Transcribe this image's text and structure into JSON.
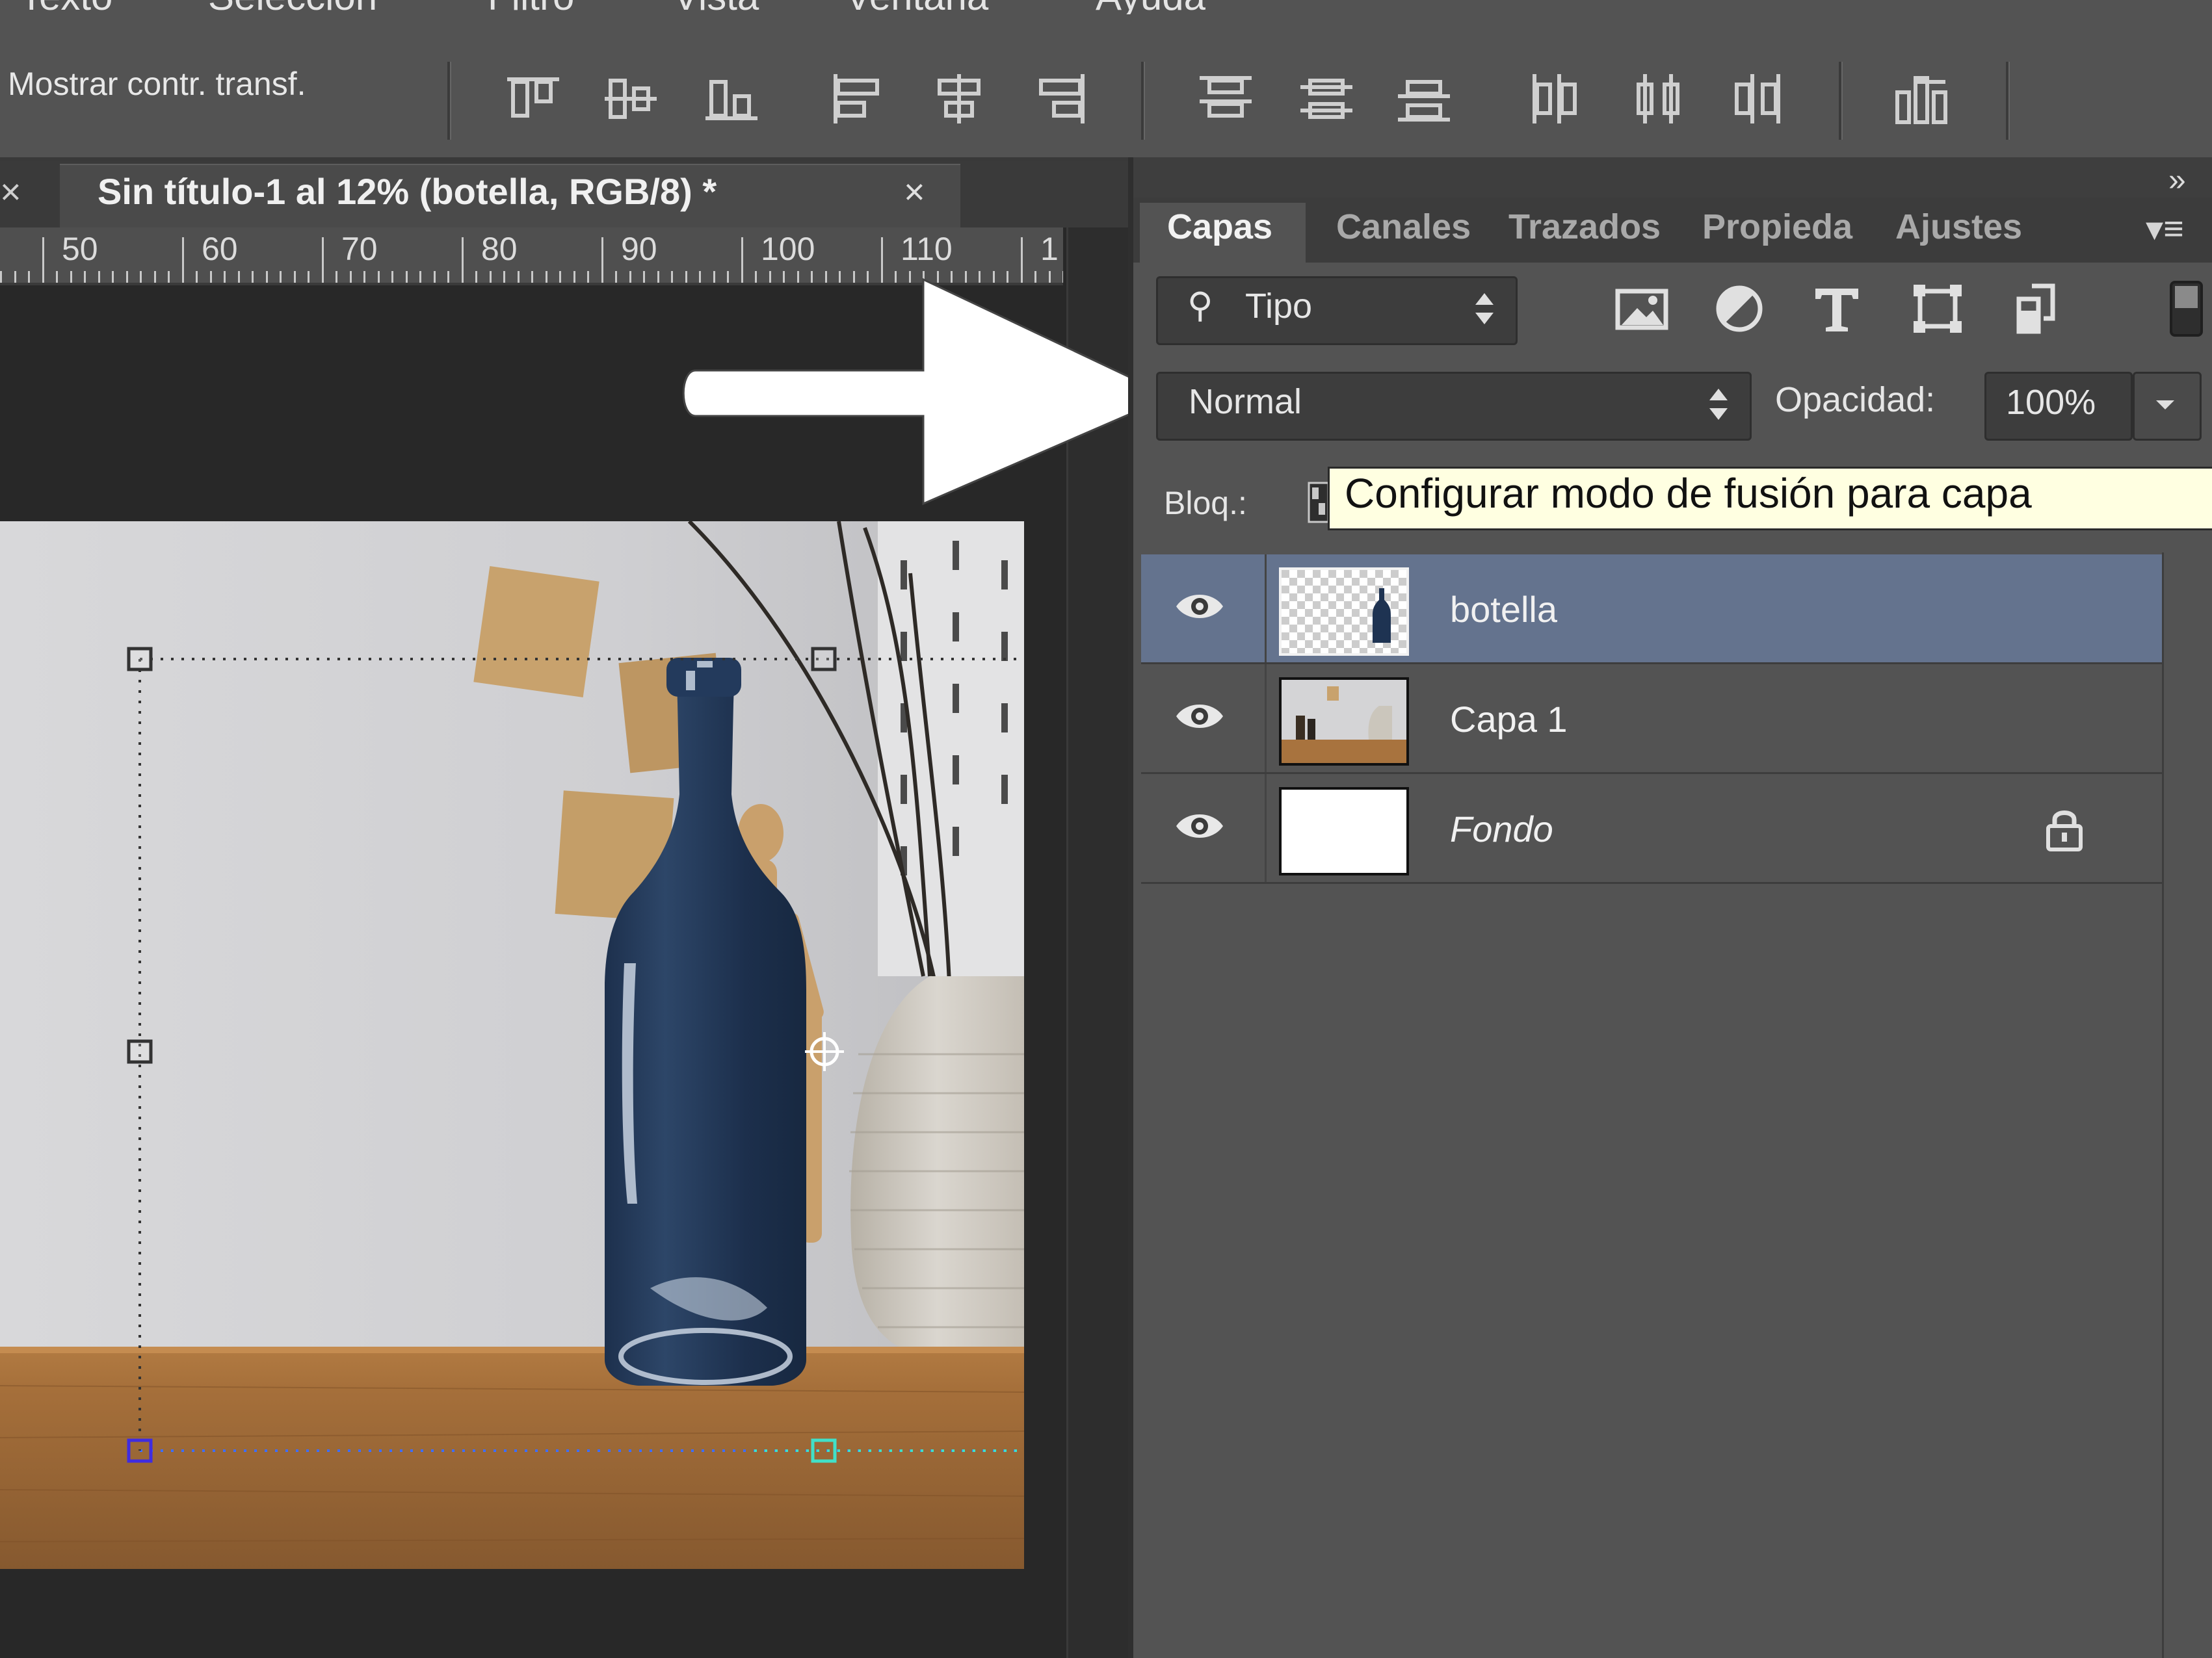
{
  "menu": {
    "items": [
      "Texto",
      "Selección",
      "Filtro",
      "Vista",
      "Ventana",
      "Ayuda"
    ]
  },
  "options_bar": {
    "show_transform_label": "Mostrar contr. transf.",
    "align_icons": [
      "align-top-edges-icon",
      "align-vertical-centers-icon",
      "align-bottom-edges-icon",
      "align-left-edges-icon",
      "align-horizontal-centers-icon",
      "align-right-edges-icon",
      "distribute-top-icon",
      "distribute-vertical-centers-icon",
      "distribute-bottom-icon",
      "distribute-left-icon",
      "distribute-horizontal-centers-icon",
      "distribute-right-icon",
      "auto-align-icon"
    ]
  },
  "document": {
    "prev_tab_close": "×",
    "tab_title": "Sin título-1 al 12% (botella, RGB/8) *",
    "tab_close": "×"
  },
  "ruler": {
    "labels": [
      "50",
      "60",
      "70",
      "80",
      "90",
      "100",
      "110",
      "1"
    ]
  },
  "panel": {
    "collapse_icon": "»",
    "tabs": [
      "Capas",
      "Canales",
      "Trazados",
      "Propieda",
      "Ajustes"
    ],
    "active_tab": "Capas",
    "menu_icon": "▾≡",
    "filter": {
      "label": "Tipo",
      "search_icon": "⚲"
    },
    "blend_mode": "Normal",
    "opacity_label": "Opacidad:",
    "opacity_value": "100%",
    "lock_label": "Bloq.:",
    "tooltip": "Configurar modo de fusión para capa",
    "layers": [
      {
        "name": "botella",
        "selected": true,
        "visible": true
      },
      {
        "name": "Capa 1",
        "selected": false,
        "visible": true
      },
      {
        "name": "Fondo",
        "selected": false,
        "visible": true,
        "locked": true,
        "italic": true
      }
    ]
  },
  "colors": {
    "ui_bg": "#535353",
    "dark_bg": "#282828",
    "selected_layer": "#64738e",
    "tooltip_bg": "#ffffe1",
    "bottle": "#1e3352"
  }
}
